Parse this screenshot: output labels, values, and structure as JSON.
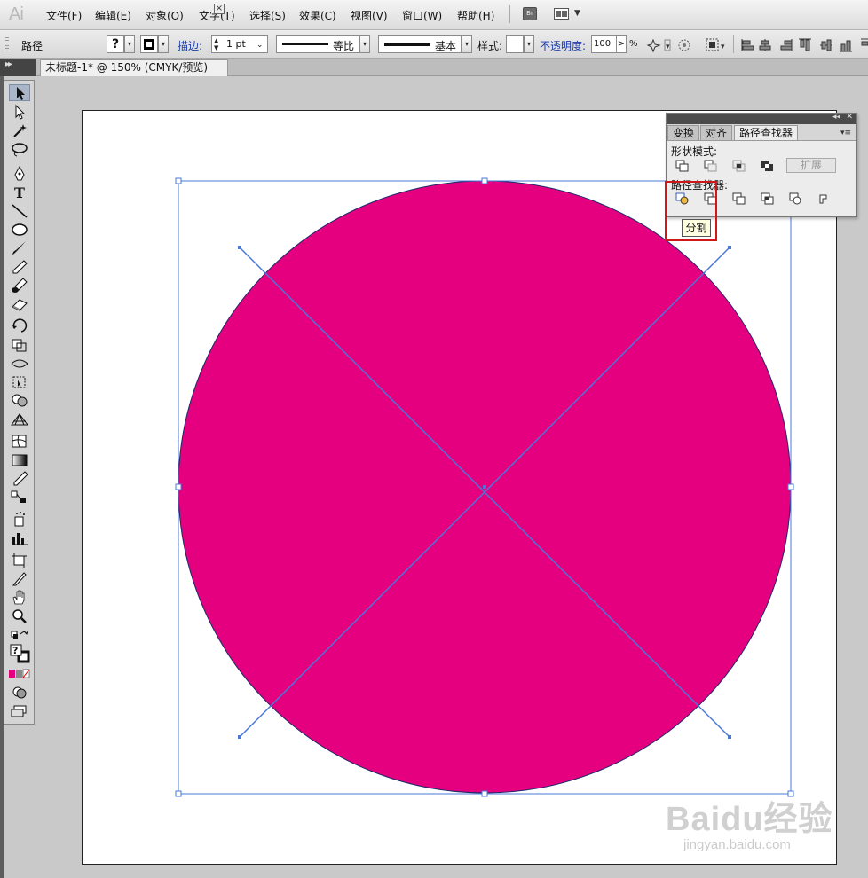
{
  "app": {
    "logo": "Ai"
  },
  "menu": {
    "items": [
      "文件(F)",
      "编辑(E)",
      "对象(O)",
      "文字(T)",
      "选择(S)",
      "效果(C)",
      "视图(V)",
      "窗口(W)",
      "帮助(H)"
    ],
    "bridge_label": "Br"
  },
  "control_bar": {
    "object_type": "路径",
    "fill_value": "?",
    "stroke_label": "描边:",
    "stroke_weight": "1 pt",
    "variable_width_label": "等比",
    "brush_label": "基本",
    "style_label": "样式:",
    "opacity_label": "不透明度:",
    "opacity_value": "100",
    "opacity_unit": "%",
    "opacity_arrow": ">"
  },
  "document": {
    "tab_title": "未标题-1* @ 150% (CMYK/预览)",
    "close": "×"
  },
  "pathfinder_panel": {
    "tabs": [
      "变换",
      "对齐",
      "路径查找器"
    ],
    "active_tab": "路径查找器",
    "shape_modes_label": "形状模式:",
    "expand_label": "扩展",
    "pathfinders_label": "路径查找器:",
    "tooltip": "分割"
  },
  "artwork": {
    "fill_color": "#e4007f",
    "selection_color": "#4a78d8"
  },
  "watermark": {
    "brand": "Baidu经验",
    "sub": "jingyan.baidu.com"
  }
}
